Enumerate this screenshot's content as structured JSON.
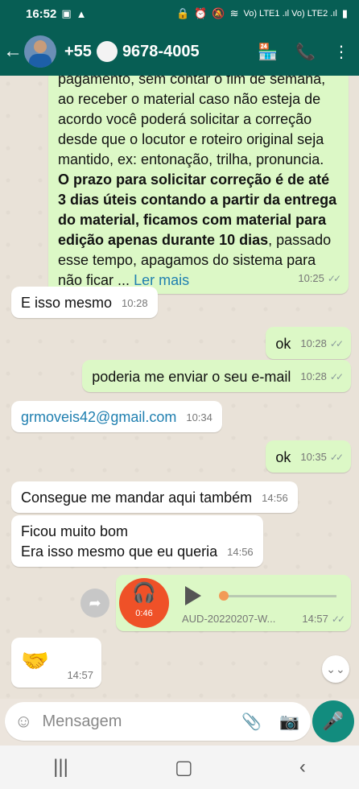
{
  "status_bar": {
    "time": "16:52",
    "right_text": "Vo) LTE1 .ıl Vo) LTE2 .ıl"
  },
  "header": {
    "contact_prefix": "+55",
    "contact_suffix": "9678-4005"
  },
  "messages": {
    "long": {
      "line1": "pagamento, sem contar o fim de semana,",
      "line2": "ao receber o material caso não esteja de",
      "line3": "acordo você poderá solicitar a correção",
      "line4": "desde que o locutor e roteiro original seja",
      "line5": "mantido, ex: entonação, trilha, pronuncia.",
      "bold1": "O prazo para solicitar correção é de até",
      "bold2": "3 dias úteis contando a partir da entrega",
      "bold3": "do material, ficamos com material para",
      "bold4": "edição apenas durante 10 dias",
      "tail4": ", passado",
      "line9": "esse tempo, apagamos do sistema para",
      "line10": "não ficar ...",
      "read_more": "Ler mais",
      "time": "10:25"
    },
    "m1": {
      "text": "E isso mesmo",
      "time": "10:28"
    },
    "m2": {
      "text": "ok",
      "time": "10:28"
    },
    "m3": {
      "text": "poderia me enviar o seu e-mail",
      "time": "10:28"
    },
    "m4": {
      "text": "grmoveis42@gmail.com",
      "time": "10:34"
    },
    "m5": {
      "text": "ok",
      "time": "10:35"
    },
    "m6": {
      "text": "Consegue me mandar aqui também",
      "time": "14:56"
    },
    "m7": {
      "line1": "Ficou muito bom",
      "line2": "Era isso mesmo que eu queria",
      "time": "14:56"
    },
    "voice": {
      "duration": "0:46",
      "filename": "AUD-20220207-W...",
      "time": "14:57",
      "progress": 0.0
    },
    "emoji": {
      "text": "🤝",
      "time": "14:57"
    }
  },
  "input": {
    "placeholder": "Mensagem"
  },
  "colors": {
    "header": "#075e54",
    "outgoing": "#dcf8c6",
    "incoming": "#ffffff",
    "accent": "#128c7e",
    "audio_head": "#ef5128"
  }
}
